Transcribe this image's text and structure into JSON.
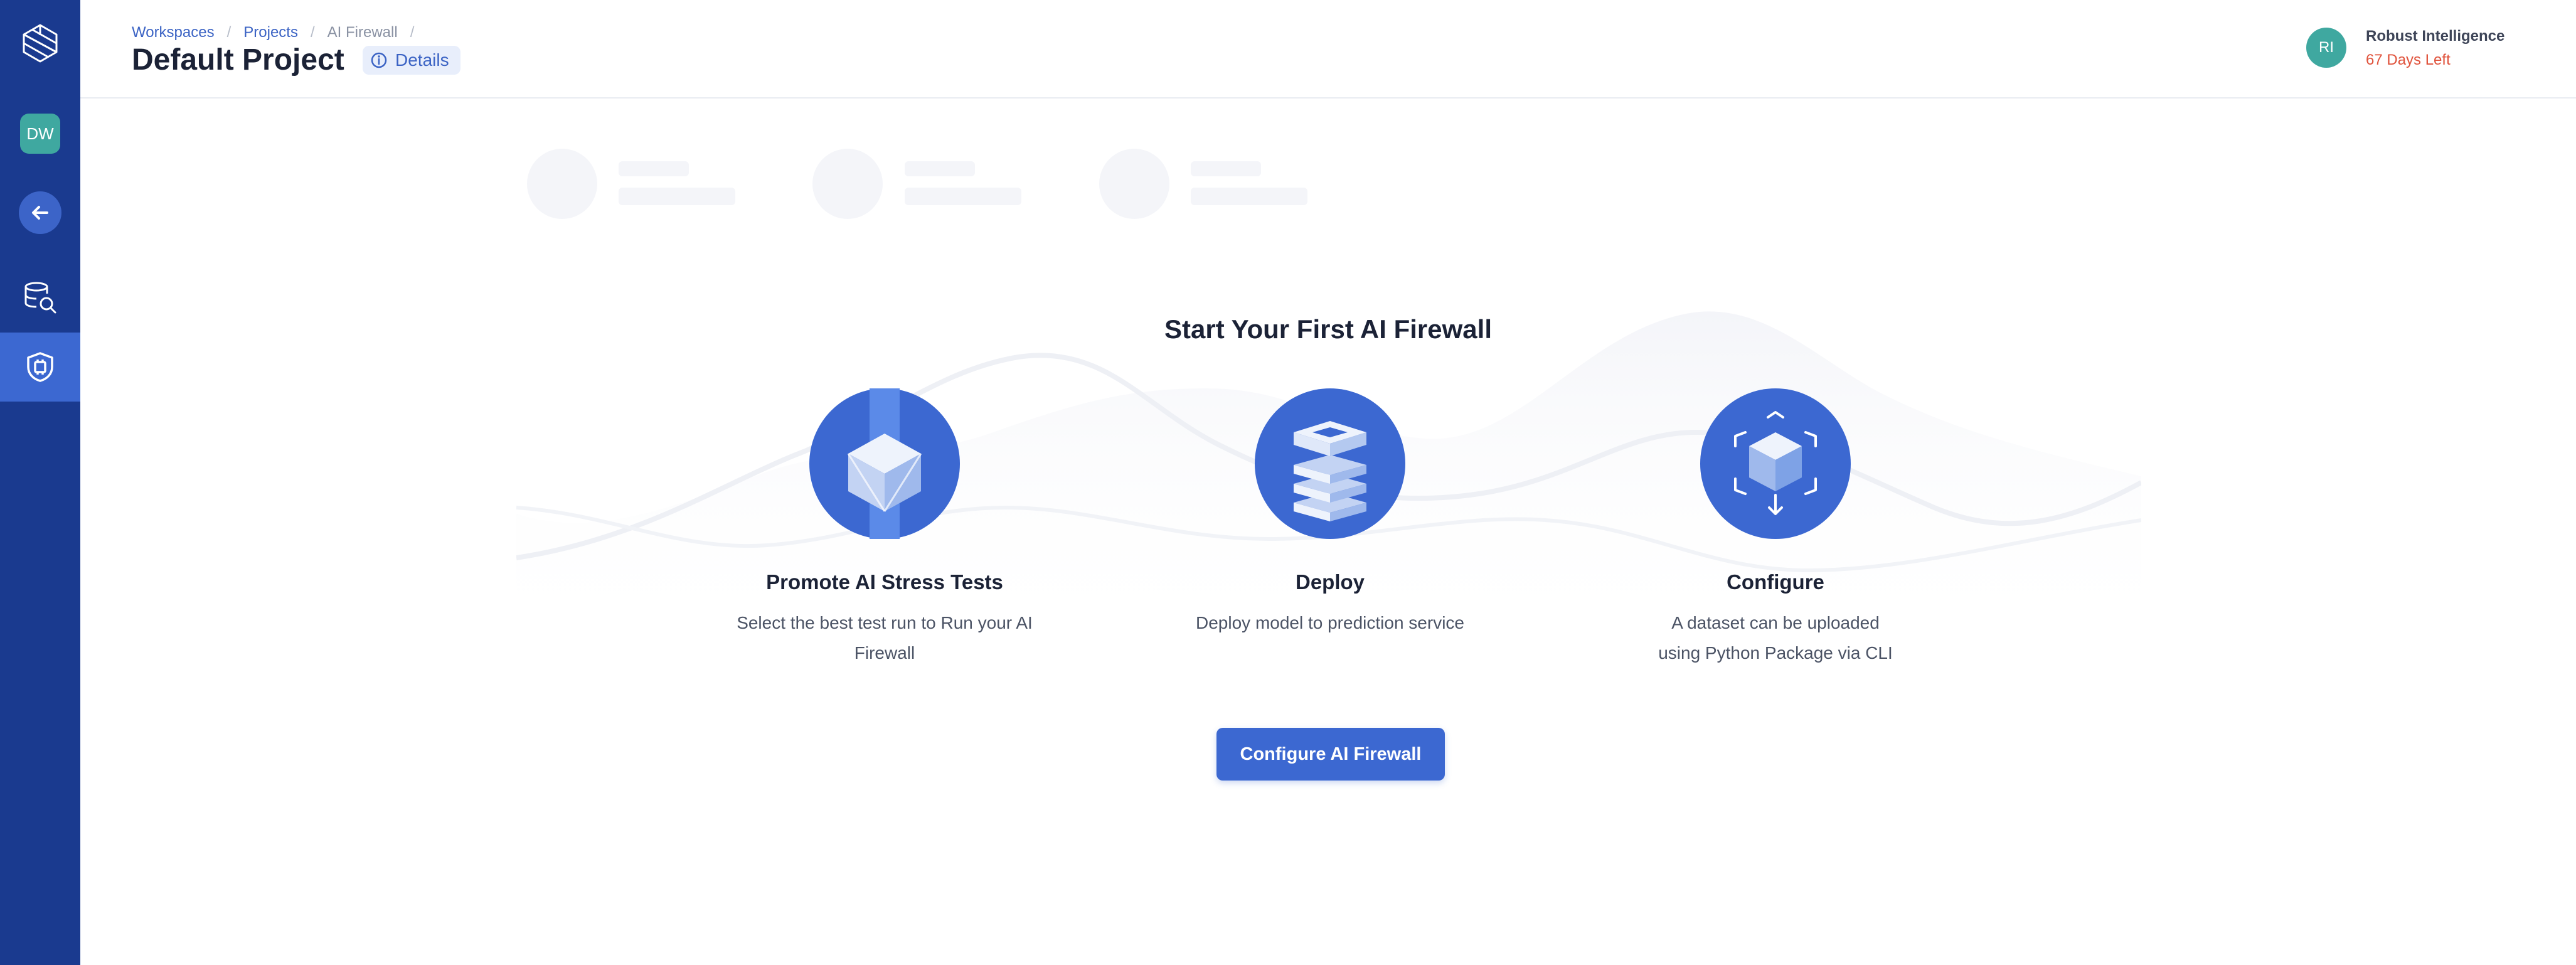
{
  "header": {
    "breadcrumb": {
      "workspaces": "Workspaces",
      "projects": "Projects",
      "current": "AI Firewall",
      "separator": "/"
    },
    "title": "Default Project",
    "details_label": "Details",
    "user": {
      "initials": "RI",
      "name": "Robust Intelligence",
      "days_left": "67 Days Left"
    }
  },
  "sidebar": {
    "workspace_initials": "DW",
    "icons": [
      "logo-icon",
      "back-arrow-icon",
      "data-search-icon",
      "firewall-shield-icon"
    ]
  },
  "main": {
    "heading": "Start Your First AI Firewall",
    "steps": [
      {
        "title": "Promote AI Stress Tests",
        "description_lines": [
          "Select the best test run to Run your AI",
          "Firewall"
        ]
      },
      {
        "title": "Deploy",
        "description_lines": [
          "Deploy model to prediction service"
        ]
      },
      {
        "title": "Configure",
        "description_lines": [
          "A dataset can be uploaded",
          "using Python Package via CLI"
        ]
      }
    ],
    "cta_label": "Configure AI Firewall"
  },
  "colors": {
    "sidebar": "#1a3a8f",
    "sidebar_active": "#3c68d1",
    "accent": "#3c68d1",
    "teal_avatar": "#3fa8a0",
    "days_left": "#e0523b",
    "link": "#3b63c4"
  }
}
